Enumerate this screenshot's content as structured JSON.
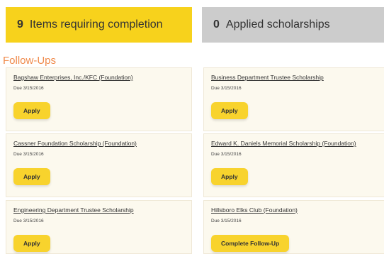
{
  "summary": {
    "required": {
      "count": "9",
      "label": "Items requiring completion"
    },
    "applied": {
      "count": "0",
      "label": "Applied scholarships"
    }
  },
  "section_title": "Follow-Ups",
  "cards": [
    {
      "title": "Bagshaw Enterprises, Inc./KFC (Foundation)",
      "due": "Due 3/15/2016",
      "action": "Apply"
    },
    {
      "title": "Business Department Trustee Scholarship",
      "due": "Due 3/15/2016",
      "action": "Apply"
    },
    {
      "title": "Cassner Foundation Scholarship (Foundation)",
      "due": "Due 3/15/2016",
      "action": "Apply"
    },
    {
      "title": "Edward K. Daniels Memorial Scholarship (Foundation)",
      "due": "Due 3/15/2016",
      "action": "Apply"
    },
    {
      "title": "Engineering Department Trustee Scholarship",
      "due": "Due 3/15/2016",
      "action": "Apply"
    },
    {
      "title": "Hillsboro Elks Club (Foundation)",
      "due": "Due 3/15/2016",
      "action": "Complete Follow-Up"
    }
  ],
  "colors": {
    "required_tile": "#f7d21c",
    "applied_tile": "#cccccc",
    "section_title": "#f08a4b",
    "card_background": "#fcf9ee",
    "button": "#f8d32d"
  }
}
